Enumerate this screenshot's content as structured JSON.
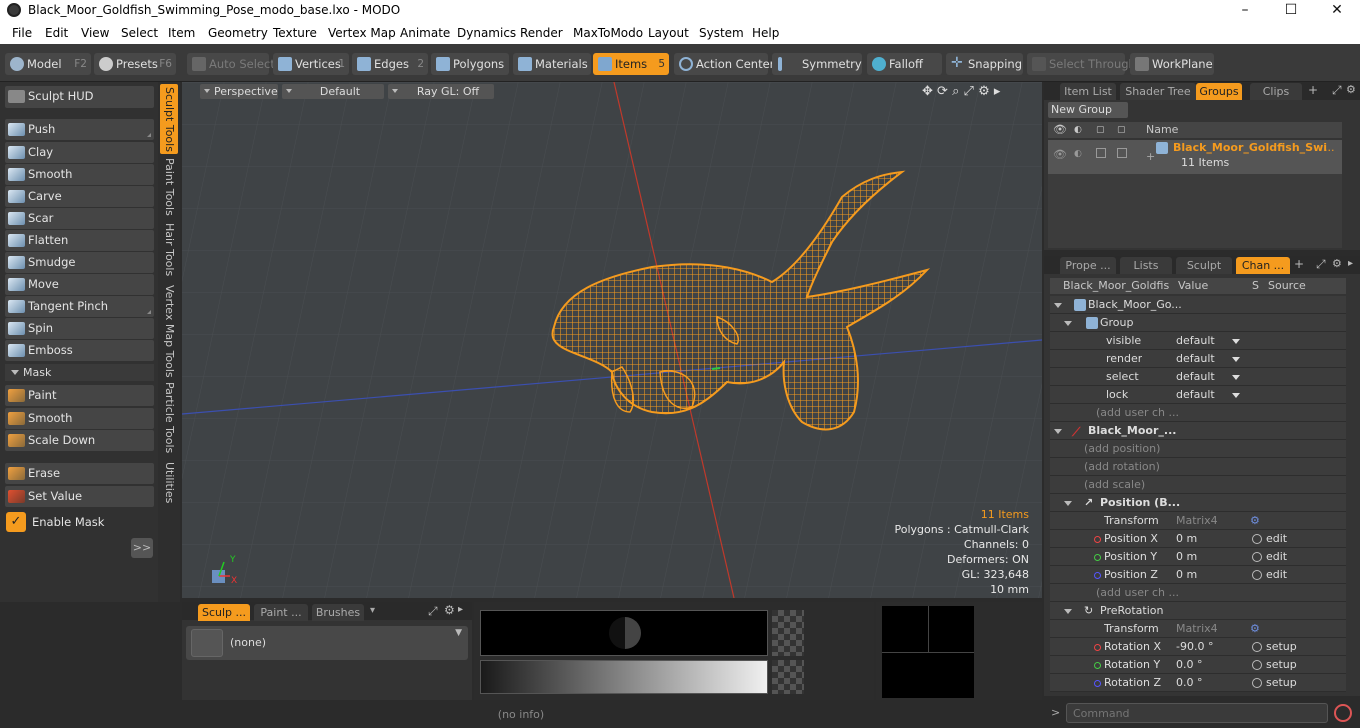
{
  "window": {
    "title": "Black_Moor_Goldfish_Swimming_Pose_modo_base.lxo - MODO",
    "minimize": "–",
    "maximize": "☐",
    "close": "✕"
  },
  "menu": [
    "File",
    "Edit",
    "View",
    "Select",
    "Item",
    "Geometry",
    "Texture",
    "Vertex Map",
    "Animate",
    "Dynamics",
    "Render",
    "MaxToModo",
    "Layout",
    "System",
    "Help"
  ],
  "toolbar": {
    "model": "Model",
    "model_key": "F2",
    "presets": "Presets",
    "presets_key": "F6",
    "auto_select": "Auto Select",
    "vertices": "Vertices",
    "vertices_key": "1",
    "edges": "Edges",
    "edges_key": "2",
    "polygons": "Polygons",
    "materials": "Materials",
    "items": "Items",
    "items_key": "5",
    "action_center": "Action Center",
    "symmetry": "Symmetry",
    "falloff": "Falloff",
    "snapping": "Snapping",
    "select_through": "Select Through",
    "workplane": "WorkPlane"
  },
  "sculpt": {
    "hud": "Sculpt HUD",
    "tools": [
      "Push",
      "Clay",
      "Smooth",
      "Carve",
      "Scar",
      "Flatten",
      "Smudge",
      "Move",
      "Tangent Pinch",
      "Spin",
      "Emboss"
    ],
    "mask_header": "Mask",
    "mask_tools": [
      "Paint",
      "Smooth",
      "Scale Down"
    ],
    "erase": "Erase",
    "set_value": "Set Value",
    "enable_mask": "Enable Mask",
    "expand": ">>"
  },
  "vertical_tabs": [
    "Sculpt Tools",
    "Paint Tools",
    "Hair Tools",
    "Vertex Map Tools",
    "Particle Tools",
    "Utilities"
  ],
  "viewport": {
    "view": "Perspective",
    "shading": "Default",
    "raygl": "Ray GL: Off",
    "info": {
      "items": "11 Items",
      "polygons": "Polygons : Catmull-Clark",
      "channels": "Channels: 0",
      "deformers": "Deformers: ON",
      "gl": "GL: 323,648",
      "scale": "10 mm"
    },
    "axis_y": "Y",
    "axis_x": "X",
    "colors": {
      "mesh": "#f59b1e",
      "axis_red": "#c0392b",
      "axis_blue": "#3b4fb0"
    }
  },
  "bottom_panel": {
    "tab1": "Sculp ...",
    "tab2": "Paint ...",
    "tab3": "Brushes",
    "brush": "(none)"
  },
  "status": "(no info)",
  "right_top": {
    "tabs": [
      "Item List",
      "Shader Tree",
      "Groups",
      "Clips"
    ],
    "new_group": "New Group",
    "col_name": "Name",
    "group_name": "Black_Moor_Goldfish_Swi",
    "group_count": "11 Items"
  },
  "right_bottom": {
    "tabs": [
      "Prope ...",
      "Lists",
      "Sculpt",
      "Chan ..."
    ],
    "col_item": "Black_Moor_Goldfis ...",
    "col_value": "Value",
    "col_s": "S",
    "col_source": "Source",
    "rows": {
      "r0": "Black_Moor_Go...",
      "r1": "Group",
      "visible": "visible",
      "visible_v": "default",
      "render": "render",
      "render_v": "default",
      "select": "select",
      "select_v": "default",
      "lock": "lock",
      "lock_v": "default",
      "add_user1": "(add user ch ...",
      "mesh": "Black_Moor_...",
      "add_pos": "(add position)",
      "add_rot": "(add rotation)",
      "add_scale": "(add scale)",
      "position": "Position (B...",
      "transform1": "Transform",
      "transform1_v": "Matrix4",
      "posx": "Position X",
      "posx_v": "0 m",
      "posx_s": "edit",
      "posy": "Position Y",
      "posy_v": "0 m",
      "posy_s": "edit",
      "posz": "Position Z",
      "posz_v": "0 m",
      "posz_s": "edit",
      "add_user2": "(add user ch ...",
      "prerot": "PreRotation",
      "transform2": "Transform",
      "transform2_v": "Matrix4",
      "rotx": "Rotation X",
      "rotx_v": "-90.0 °",
      "rotx_s": "setup",
      "roty": "Rotation Y",
      "roty_v": "0.0 °",
      "roty_s": "setup",
      "rotz": "Rotation Z",
      "rotz_v": "0.0 °",
      "rotz_s": "setup"
    }
  },
  "command": {
    "placeholder": "Command",
    "prompt": ">"
  }
}
